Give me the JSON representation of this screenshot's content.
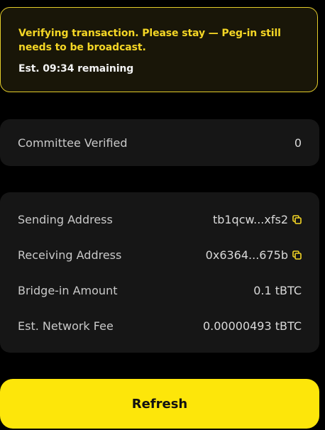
{
  "warning": {
    "message": "Verifying transaction. Please stay — Peg-in still needs to be broadcast.",
    "time_remaining": "Est. 09:34 remaining"
  },
  "committee": {
    "label": "Committee Verified",
    "value": "0"
  },
  "details": {
    "sending_address": {
      "label": "Sending Address",
      "value": "tb1qcw...xfs2",
      "icon": "copy-icon"
    },
    "receiving_address": {
      "label": "Receiving Address",
      "value": "0x6364...675b",
      "icon": "copy-icon"
    },
    "bridge_in_amount": {
      "label": "Bridge-in Amount",
      "value": "0.1 tBTC"
    },
    "network_fee": {
      "label": "Est. Network Fee",
      "value": "0.00000493 tBTC"
    }
  },
  "refresh_button": {
    "label": "Refresh"
  },
  "colors": {
    "accent": "#fde60a",
    "warning_text": "#f4d625",
    "warning_border": "#e3cc2a",
    "card_background": "#161616",
    "page_background": "#000000"
  }
}
